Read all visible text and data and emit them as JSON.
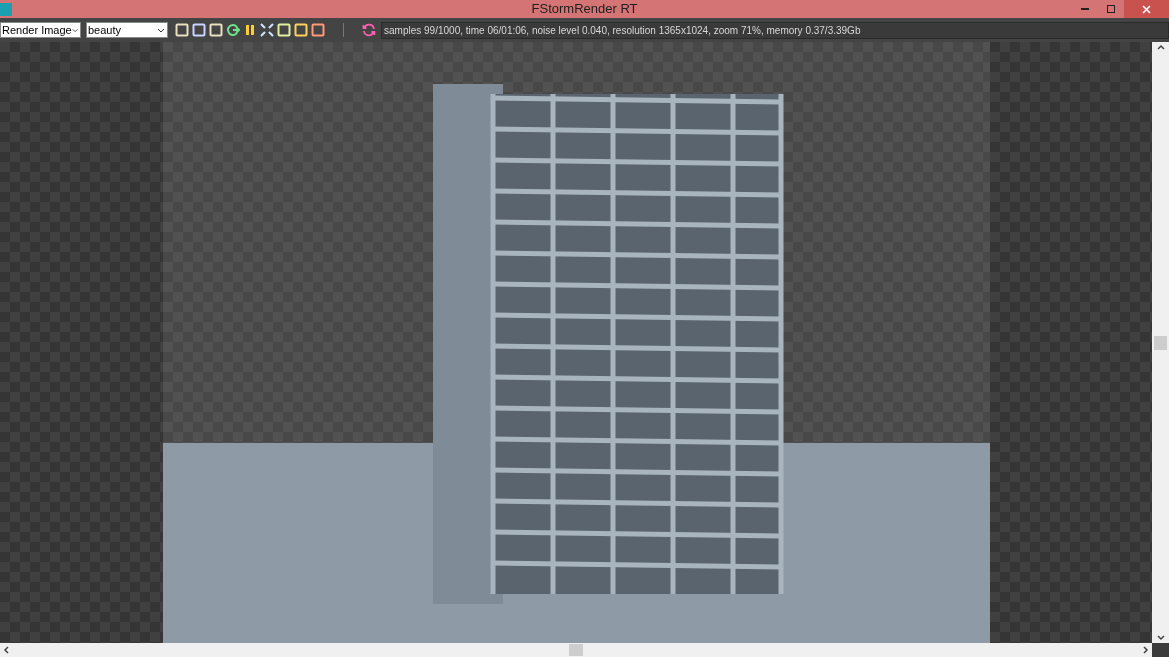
{
  "window": {
    "title": "FStormRender RT"
  },
  "toolbar": {
    "dropdowns": [
      {
        "value": "Render Image"
      },
      {
        "value": "beauty"
      }
    ],
    "status": "samples 99/1000,  time 06/01:06,  noise level 0.040,  resolution 1365x1024,  zoom 71%,  memory 0.37/3.39Gb"
  }
}
